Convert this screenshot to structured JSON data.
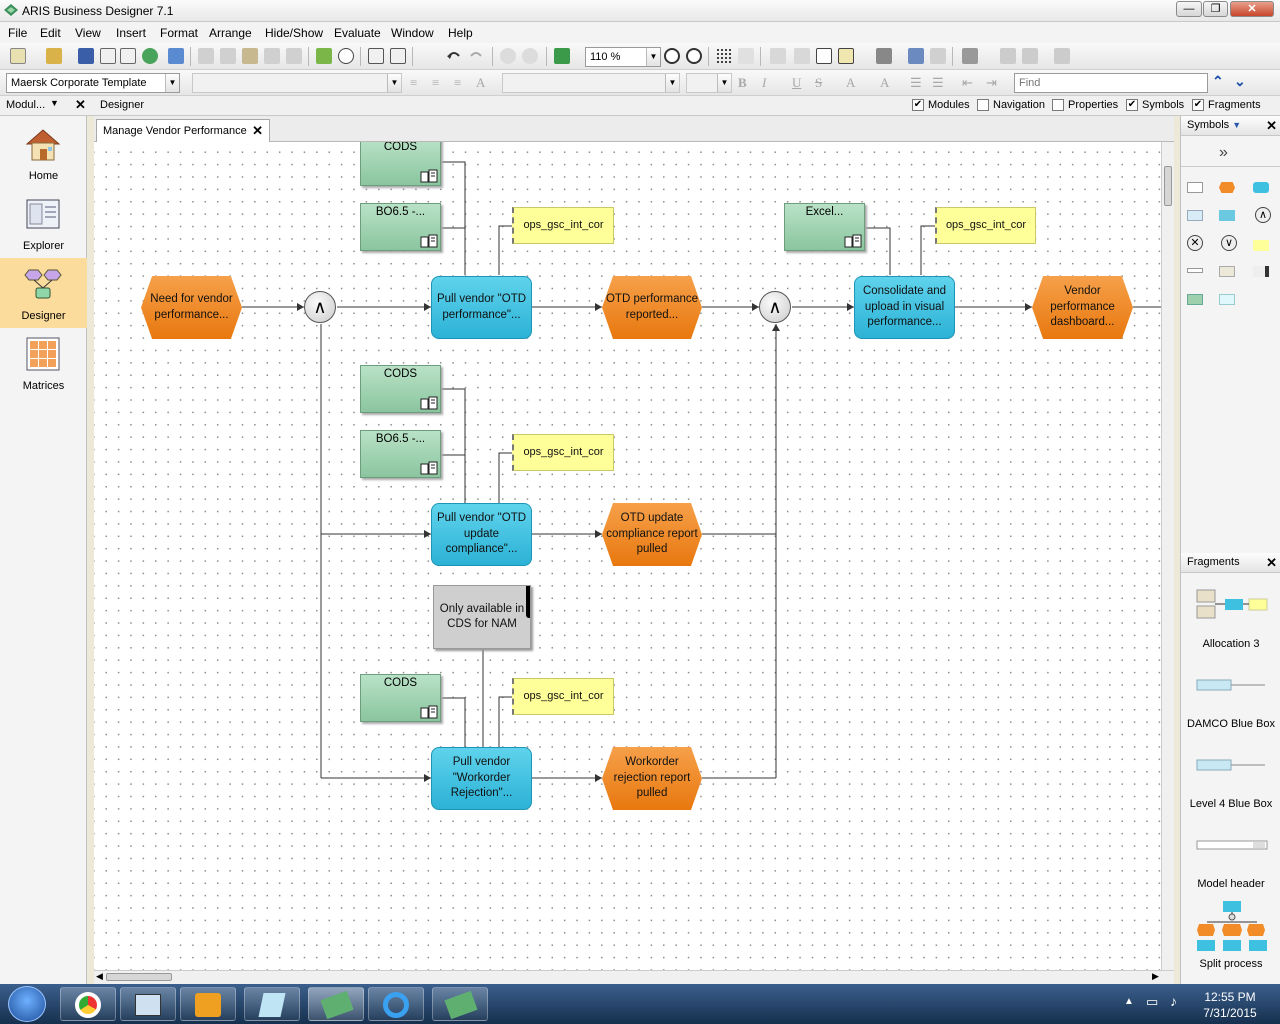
{
  "window": {
    "title": "ARIS Business Designer 7.1",
    "minimize": "—",
    "maximize": "❐",
    "close": "✕"
  },
  "menu": [
    "File",
    "Edit",
    "View",
    "Insert",
    "Format",
    "Arrange",
    "Hide/Show",
    "Evaluate",
    "Window",
    "Help"
  ],
  "toolbar": {
    "zoom": "110 %"
  },
  "format_bar": {
    "template": "Maersk Corporate Template",
    "font": "",
    "size": "",
    "find_placeholder": "Find"
  },
  "panel_bar": {
    "modules_label": "Modul...",
    "designer_label": "Designer",
    "options": [
      {
        "label": "Modules",
        "checked": true
      },
      {
        "label": "Navigation",
        "checked": false
      },
      {
        "label": "Properties",
        "checked": false
      },
      {
        "label": "Symbols",
        "checked": true
      },
      {
        "label": "Fragments",
        "checked": true
      }
    ]
  },
  "modules": [
    {
      "label": "Home",
      "icon": "home-icon",
      "active": false
    },
    {
      "label": "Explorer",
      "icon": "explorer-icon",
      "active": false
    },
    {
      "label": "Designer",
      "icon": "designer-icon",
      "active": true
    },
    {
      "label": "Matrices",
      "icon": "matrices-icon",
      "active": false
    }
  ],
  "tab": {
    "label": "Manage Vendor Performance",
    "close": "✕"
  },
  "model": {
    "events": [
      {
        "id": "ev1",
        "text": "Need for vendor performance..."
      },
      {
        "id": "ev2",
        "text": "OTD performance reported..."
      },
      {
        "id": "ev3",
        "text": "Vendor performance dashboard..."
      },
      {
        "id": "ev4",
        "text": "OTD update compliance report pulled"
      },
      {
        "id": "ev5",
        "text": "Workorder rejection report pulled"
      }
    ],
    "functions": [
      {
        "id": "fn1",
        "text": "Pull vendor \"OTD performance\"..."
      },
      {
        "id": "fn2",
        "text": "Consolidate and upload in visual performance..."
      },
      {
        "id": "fn3",
        "text": "Pull vendor \"OTD update compliance\"..."
      },
      {
        "id": "fn4",
        "text": "Pull vendor \"Workorder Rejection\"..."
      }
    ],
    "systems": [
      {
        "id": "sy1",
        "text": "CODS"
      },
      {
        "id": "sy2",
        "text": "BO6.5 -..."
      },
      {
        "id": "sy3",
        "text": "Excel..."
      },
      {
        "id": "sy4",
        "text": "CODS"
      },
      {
        "id": "sy5",
        "text": "BO6.5 -..."
      },
      {
        "id": "sy6",
        "text": "CODS"
      }
    ],
    "roles": [
      {
        "id": "ro1",
        "text": "ops_gsc_int_cor"
      },
      {
        "id": "ro2",
        "text": "ops_gsc_int_cor"
      },
      {
        "id": "ro3",
        "text": "ops_gsc_int_cor"
      },
      {
        "id": "ro4",
        "text": "ops_gsc_int_cor"
      }
    ],
    "note": {
      "text": "Only available in CDS for NAM"
    },
    "gateway_symbol": "∧"
  },
  "symbols_panel": {
    "title": "Symbols",
    "expand": "»",
    "close": "✕"
  },
  "fragments_panel": {
    "title": "Fragments",
    "close": "✕",
    "items": [
      "Allocation 3",
      "DAMCO Blue Box",
      "Level 4 Blue Box",
      "Model header",
      "Split process"
    ]
  },
  "taskbar": {
    "time": "12:55 PM",
    "date": "7/31/2015"
  },
  "colors": {
    "event": "#f28c28",
    "function": "#3ec0e0",
    "system": "#9fd0ae",
    "role": "#ffff99",
    "note": "#cfcfcf",
    "active_module": "#fbdc9c"
  }
}
